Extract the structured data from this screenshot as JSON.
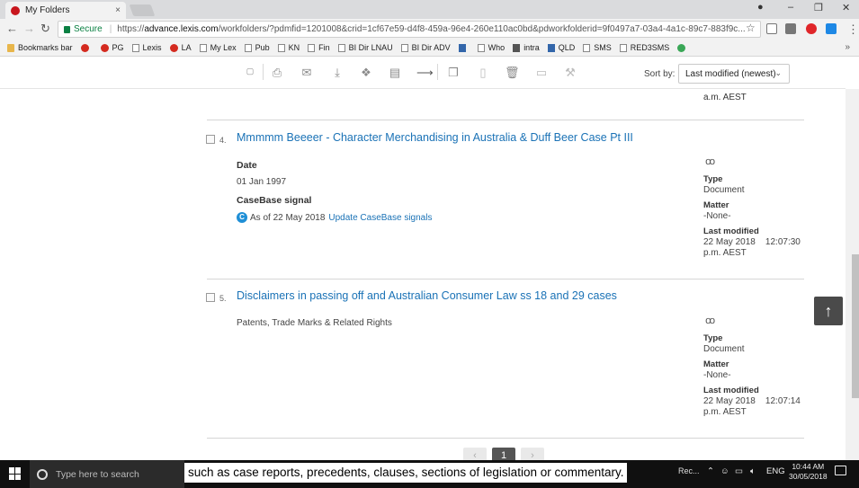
{
  "browser": {
    "tab_title": "My Folders",
    "tab_close": "×",
    "window_controls": {
      "profile": "●",
      "minimize": "–",
      "restore": "❐",
      "close": "✕"
    },
    "nav": {
      "back": "←",
      "forward": "→",
      "reload": "↻"
    },
    "secure_label": "Secure",
    "url_prefix": "https://",
    "url_host": "advance.lexis.com",
    "url_path": "/workfolders/?pdmfid=1201008&crid=1cf67e59-d4f8-459a-96e4-260e110ac0bd&pdworkfolderid=9f0497a7-03a4-4a1c-89c7-883f9c...",
    "star": "☆",
    "menu": "⋮",
    "bookmarks": [
      {
        "label": "Bookmarks bar",
        "icon": "folder-icon"
      },
      {
        "label": "",
        "icon": "red-logo-icon"
      },
      {
        "label": "PG",
        "icon": "red-logo-icon"
      },
      {
        "label": "Lexis",
        "icon": "page-icon"
      },
      {
        "label": "LA",
        "icon": "red-logo-icon"
      },
      {
        "label": "My Lex",
        "icon": "page-icon"
      },
      {
        "label": "Pub",
        "icon": "page-icon"
      },
      {
        "label": "KN",
        "icon": "page-icon"
      },
      {
        "label": "Fin",
        "icon": "page-icon"
      },
      {
        "label": "BI Dir LNAU",
        "icon": "page-icon"
      },
      {
        "label": "BI Dir ADV",
        "icon": "page-icon"
      },
      {
        "label": "",
        "icon": "chart-icon"
      },
      {
        "label": "Who",
        "icon": "page-icon"
      },
      {
        "label": "intra",
        "icon": "app-icon"
      },
      {
        "label": "QLD",
        "icon": "blue-s-icon"
      },
      {
        "label": "SMS",
        "icon": "page-icon"
      },
      {
        "label": "RED3SMS",
        "icon": "page-icon"
      },
      {
        "label": "",
        "icon": "chrome-icon"
      }
    ],
    "bookmarks_more": "»"
  },
  "toolbar": {
    "sort_label": "Sort by:",
    "sort_value": "Last modified (newest)",
    "sort_chevron": "⌄",
    "icons": [
      "checkbox-icon",
      "print-icon",
      "email-icon",
      "download-icon",
      "dropbox-icon",
      "document-icon",
      "send-to-icon",
      "copy-icon",
      "file-icon",
      "delete-icon",
      "move-folder-icon",
      "tools-icon"
    ]
  },
  "previous_item_tail": "a.m. AEST",
  "documents": [
    {
      "number": "4.",
      "title": "Mmmmm Beeeer - Character Merchandising in Australia & Duff Beer Case Pt III",
      "date_label": "Date",
      "date_value": "01 Jan 1997",
      "signal_label": "CaseBase signal",
      "signal_badge": "C",
      "signal_text": "As of 22 May 2018",
      "signal_link": "Update CaseBase signals",
      "view_icon": "ꝏ",
      "type_label": "Type",
      "type_value": "Document",
      "matter_label": "Matter",
      "matter_value": "-None-",
      "modified_label": "Last modified",
      "modified_line1": "22 May 2018    12:07:30",
      "modified_line2": "p.m. AEST"
    },
    {
      "number": "5.",
      "title": "Disclaimers in passing off and Australian Consumer Law ss 18 and 29 cases",
      "subtitle": "Patents, Trade Marks & Related Rights",
      "view_icon": "ꝏ",
      "type_label": "Type",
      "type_value": "Document",
      "matter_label": "Matter",
      "matter_value": "-None-",
      "modified_label": "Last modified",
      "modified_line1": "22 May 2018    12:07:14",
      "modified_line2": "p.m. AEST"
    }
  ],
  "pagination": {
    "prev": "‹",
    "current": "1",
    "next": "›"
  },
  "back_to_top": "↑",
  "taskbar": {
    "search_placeholder": "Type here to search",
    "caption": "such as case reports, precedents, clauses, sections of legislation or commentary.",
    "app_label": "Rec...",
    "tray_lang": "ENG",
    "time": "10:44 AM",
    "date": "30/05/2018"
  }
}
